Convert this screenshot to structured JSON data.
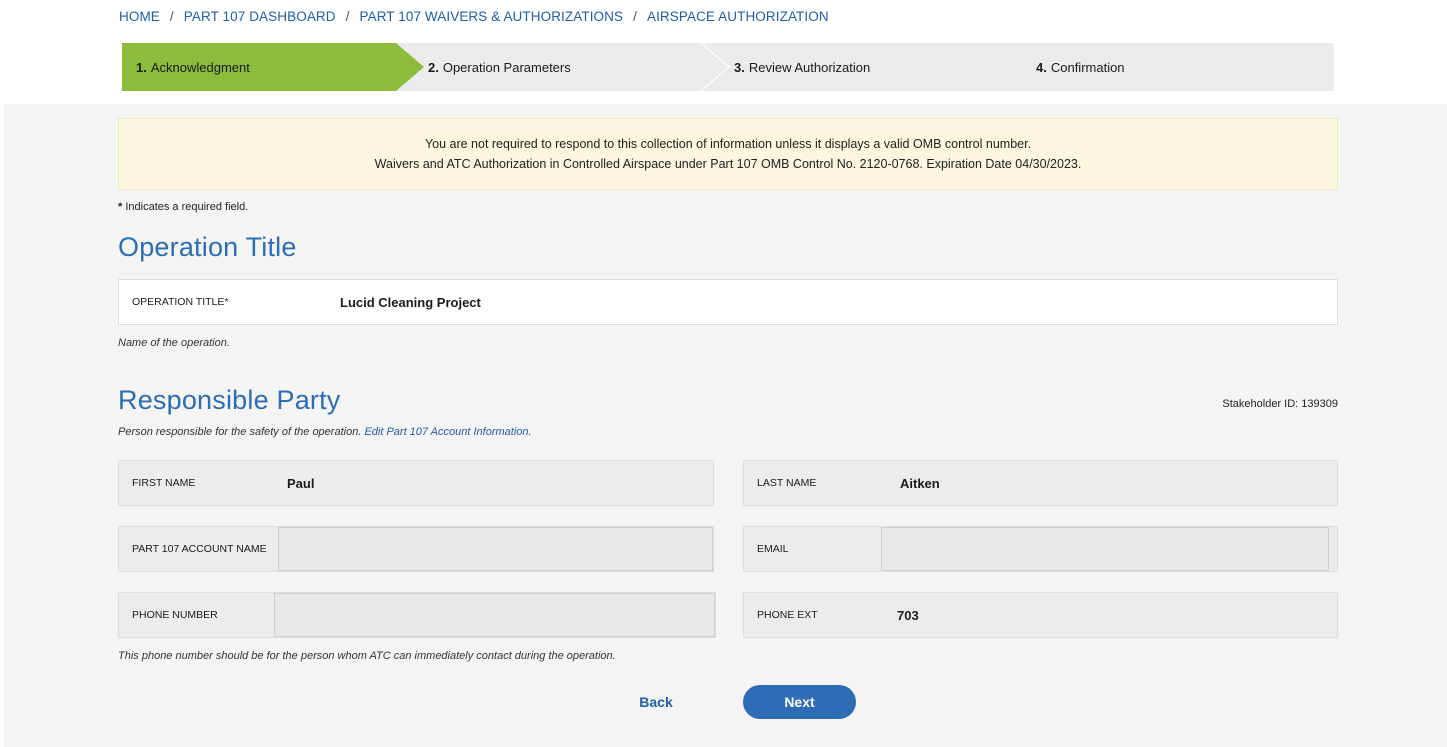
{
  "breadcrumb": {
    "items": [
      "HOME",
      "PART 107 DASHBOARD",
      "PART 107 WAIVERS & AUTHORIZATIONS",
      "AIRSPACE AUTHORIZATION"
    ],
    "separator": "/"
  },
  "stepper": {
    "steps": [
      {
        "num": "1.",
        "label": "Acknowledgment",
        "active": true
      },
      {
        "num": "2.",
        "label": "Operation Parameters",
        "active": false
      },
      {
        "num": "3.",
        "label": "Review Authorization",
        "active": false
      },
      {
        "num": "4.",
        "label": "Confirmation",
        "active": false
      }
    ],
    "active_color": "#8cbc3c"
  },
  "notice": {
    "line1": "You are not required to respond to this collection of information unless it displays a valid OMB control number.",
    "line2": "Waivers and ATC Authorization in Controlled Airspace under Part 107 OMB Control No. 2120-0768. Expiration Date 04/30/2023."
  },
  "required_note": {
    "star": "*",
    "text": " Indicates a required field."
  },
  "operation": {
    "heading": "Operation Title",
    "field_label": "OPERATION TITLE*",
    "field_value": "Lucid Cleaning Project",
    "helper": "Name of the operation."
  },
  "responsible": {
    "heading": "Responsible Party",
    "stakeholder": "Stakeholder ID: 139309",
    "helper_text": "Person responsible for the safety of the operation. ",
    "helper_link": "Edit Part 107 Account Information.",
    "first_name_label": "FIRST NAME",
    "first_name_value": "Paul",
    "last_name_label": "LAST NAME",
    "last_name_value": "Aitken",
    "account_label": "PART 107 ACCOUNT NAME",
    "account_value": "",
    "email_label": "EMAIL",
    "email_value": "",
    "phone_label": "PHONE NUMBER",
    "phone_value": "",
    "ext_label": "PHONE EXT",
    "ext_value": "703",
    "phone_helper": "This phone number should be for the person whom ATC can immediately contact during the operation."
  },
  "buttons": {
    "back": "Back",
    "next": "Next"
  },
  "colors": {
    "link": "#1f5ea8",
    "heading": "#2d6db3",
    "primary_button": "#2e6cb5",
    "notice_bg": "#fbf6dd"
  }
}
